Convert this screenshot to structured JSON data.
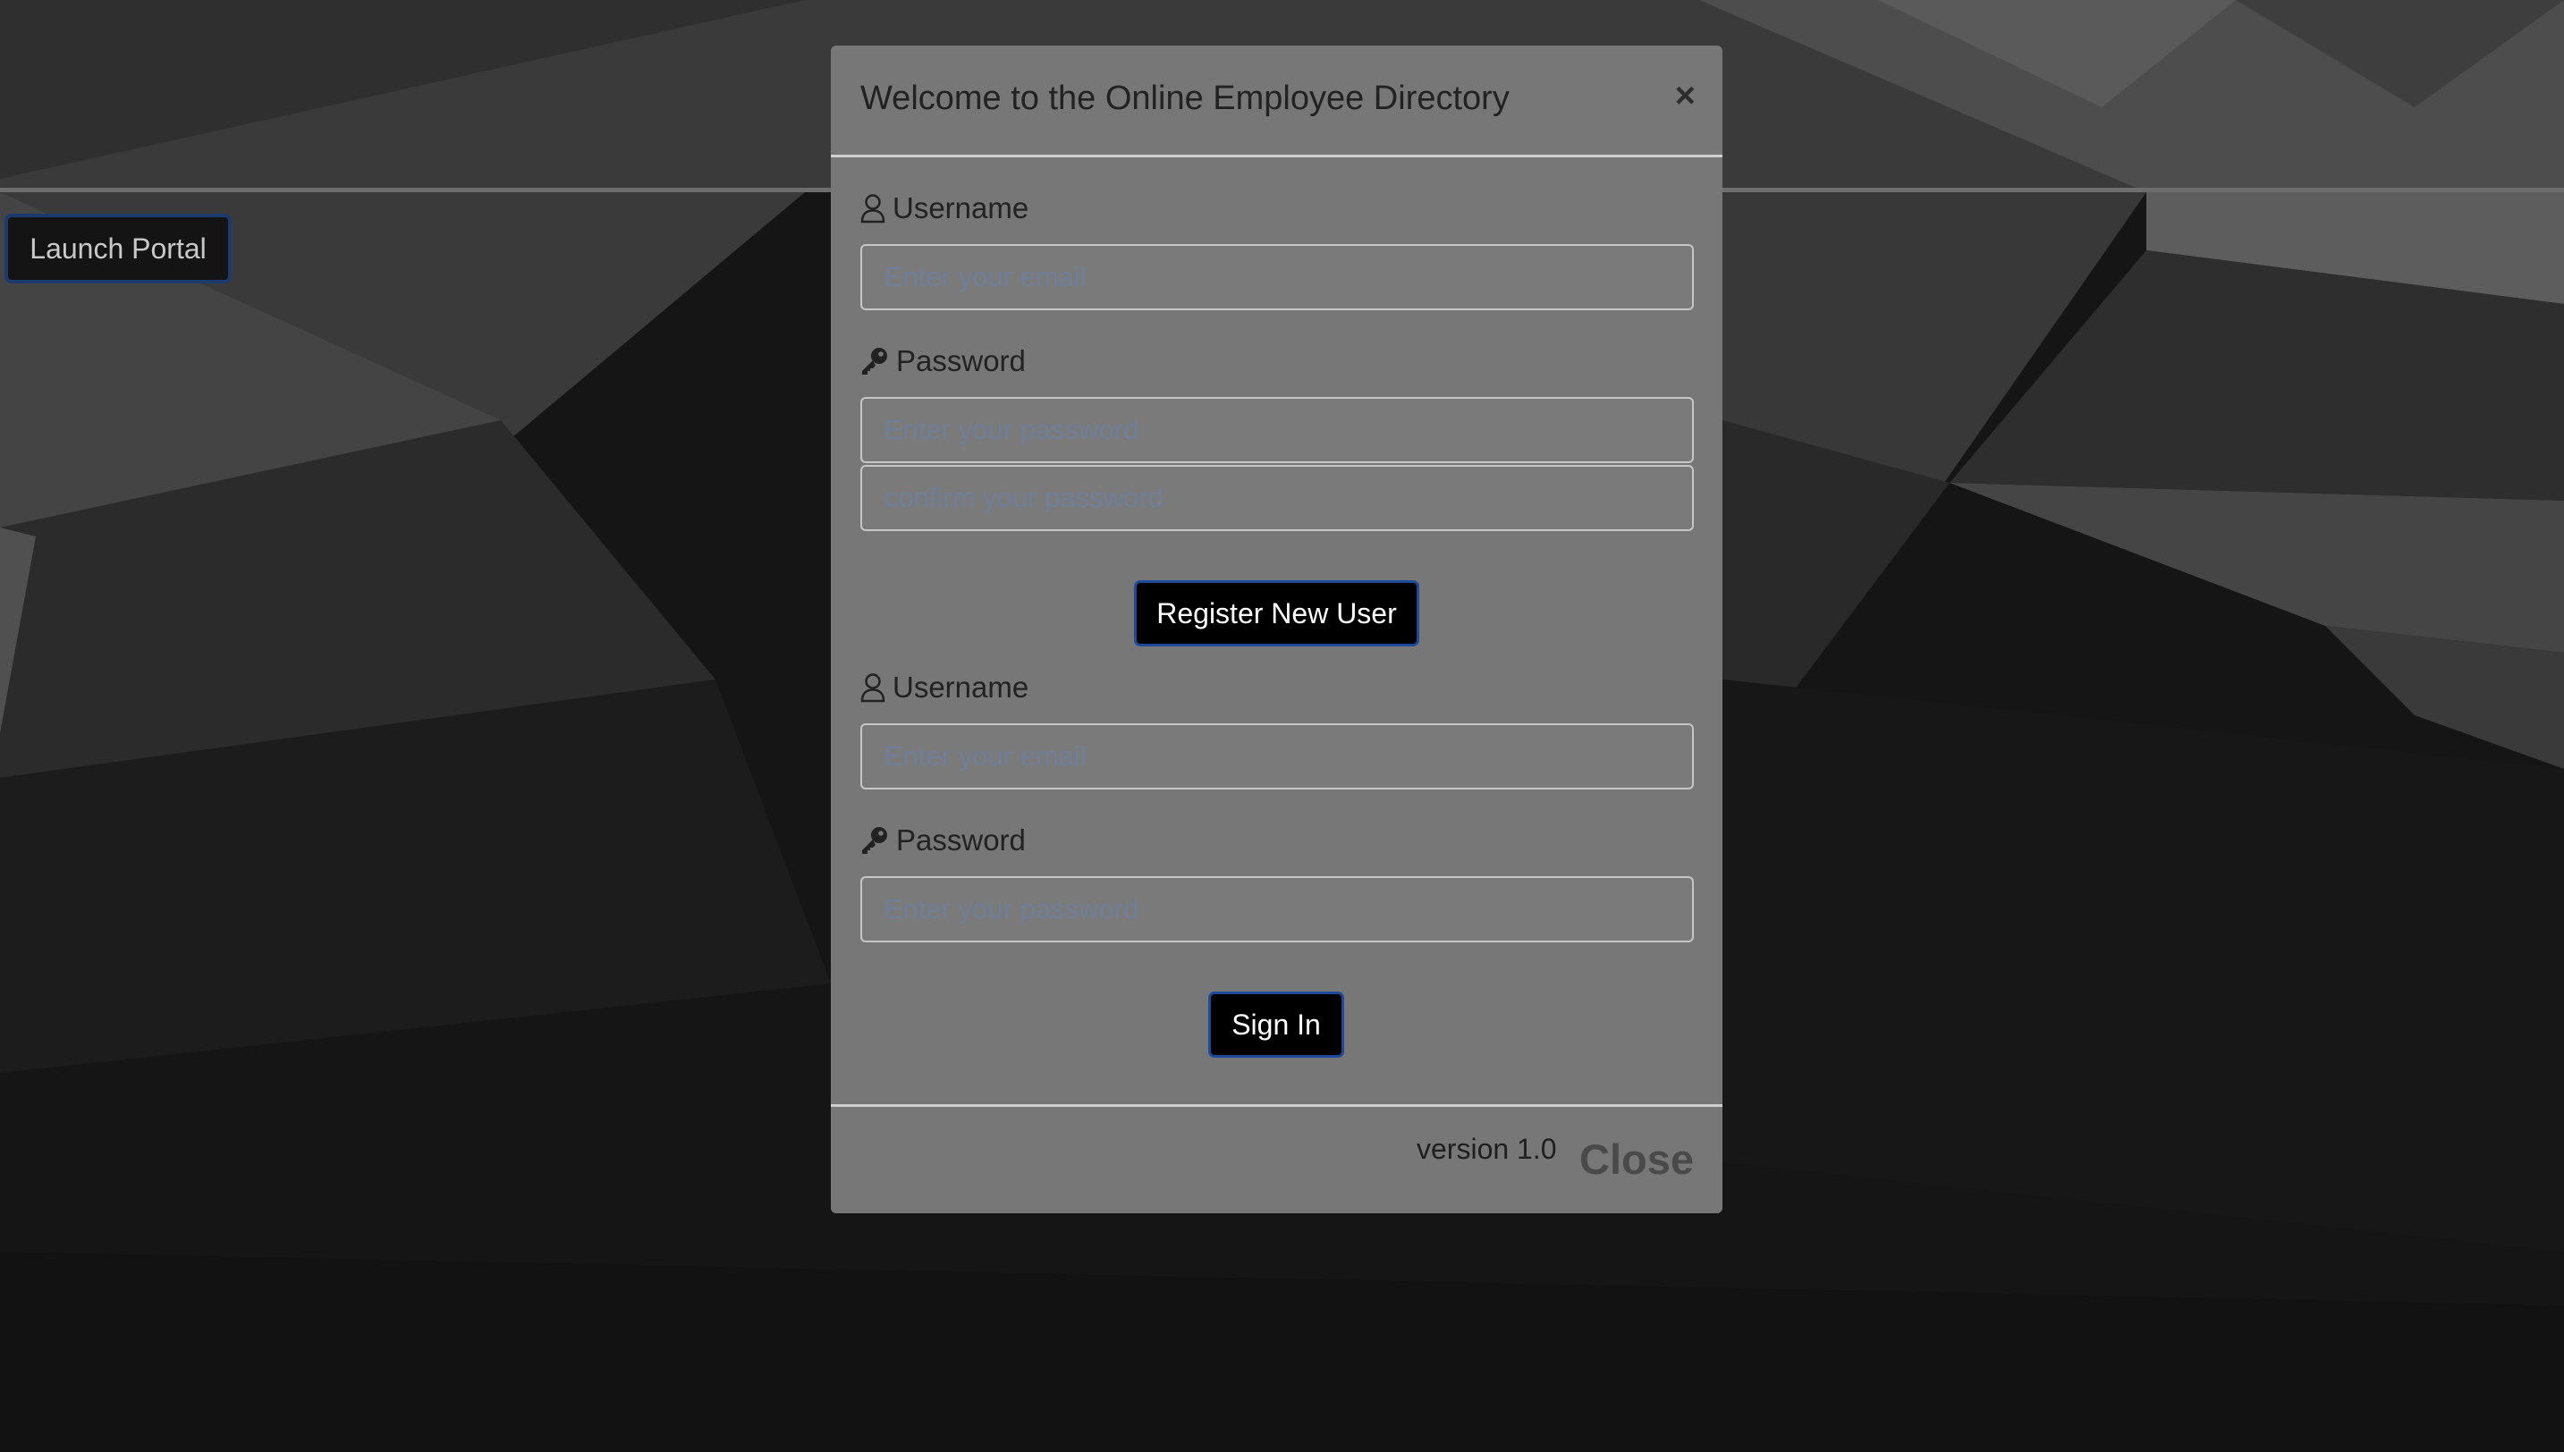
{
  "page": {
    "launch_button_label": "Launch Portal"
  },
  "modal": {
    "title": "Welcome to the Online Employee Directory",
    "close_x": "×",
    "register": {
      "username_label": "Username",
      "username_placeholder": "Enter your email",
      "password_label": "Password",
      "password_placeholder": "Enter your password",
      "confirm_placeholder": "confirm your password",
      "submit_label": "Register New User"
    },
    "signin": {
      "username_label": "Username",
      "username_placeholder": "Enter your email",
      "password_label": "Password",
      "password_placeholder": "Enter your password",
      "submit_label": "Sign In"
    },
    "footer": {
      "version": "version 1.0",
      "close_label": "Close"
    }
  },
  "icons": {
    "username": "user-icon",
    "password": "key-icon"
  },
  "colors": {
    "modal_bg": "#777777",
    "button_bg": "#000000",
    "button_border": "#1d4a9a",
    "page_bg": "#1b1b1b"
  }
}
